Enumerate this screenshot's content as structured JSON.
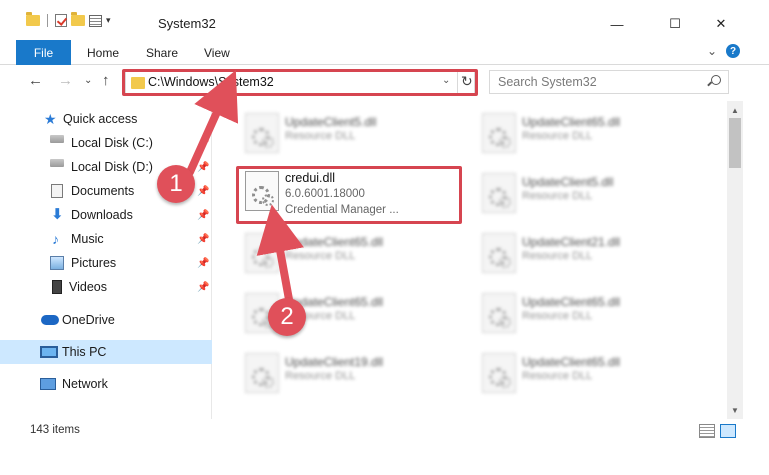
{
  "window": {
    "title": "System32",
    "minimize_glyph": "—",
    "maximize_glyph": "☐",
    "close_glyph": "✕"
  },
  "quick_access_toolbar": {
    "dropdown_glyph": "▾"
  },
  "ribbon": {
    "tabs": [
      "File",
      "Home",
      "Share",
      "View"
    ],
    "expand_glyph": "⌄",
    "help_glyph": "?"
  },
  "nav": {
    "back_glyph": "←",
    "forward_glyph": "→",
    "recent_glyph": "⌄",
    "up_glyph": "↑",
    "address": "C:\\Windows\\System32",
    "address_dropdown_glyph": "⌄",
    "refresh_glyph": "↻",
    "search_placeholder": "Search System32"
  },
  "sidebar": {
    "items": [
      {
        "label": "Quick access",
        "icon": "star-icon"
      },
      {
        "label": "Local Disk (C:)",
        "icon": "drive-icon"
      },
      {
        "label": "Local Disk (D:)",
        "icon": "drive-icon"
      },
      {
        "label": "Documents",
        "icon": "documents-icon"
      },
      {
        "label": "Downloads",
        "icon": "downloads-icon"
      },
      {
        "label": "Music",
        "icon": "music-icon"
      },
      {
        "label": "Pictures",
        "icon": "pictures-icon"
      },
      {
        "label": "Videos",
        "icon": "videos-icon"
      },
      {
        "label": "OneDrive",
        "icon": "cloud-icon"
      },
      {
        "label": "This PC",
        "icon": "computer-icon"
      },
      {
        "label": "Network",
        "icon": "network-icon"
      }
    ],
    "pin_glyph": "📌"
  },
  "files": {
    "selected": {
      "name": "credui.dll",
      "version": "6.0.6001.18000",
      "description": "Credential Manager ..."
    },
    "background_tiles": [
      {
        "name": "UpdateClient5.dll",
        "type": "Resource DLL"
      },
      {
        "name": "UpdateClient65.dll",
        "type": "Resource DLL"
      },
      {
        "name": "UpdateClient5.dll",
        "type": "Resource DLL"
      },
      {
        "name": "UpdateClient65.dll",
        "type": "Resource DLL"
      },
      {
        "name": "UpdateClient21.dll",
        "type": "Resource DLL"
      },
      {
        "name": "UpdateClient65.dll",
        "type": "Resource DLL"
      },
      {
        "name": "UpdateClient65.dll",
        "type": "Resource DLL"
      },
      {
        "name": "UpdateClient19.dll",
        "type": "Resource DLL"
      },
      {
        "name": "UpdateClient65.dll",
        "type": "Resource DLL"
      }
    ]
  },
  "scrollbar": {
    "up_glyph": "▲",
    "down_glyph": "▼"
  },
  "status": {
    "item_count": "143 items"
  },
  "annotations": {
    "step1": "1",
    "step2": "2",
    "highlight_color": "#d64550"
  }
}
